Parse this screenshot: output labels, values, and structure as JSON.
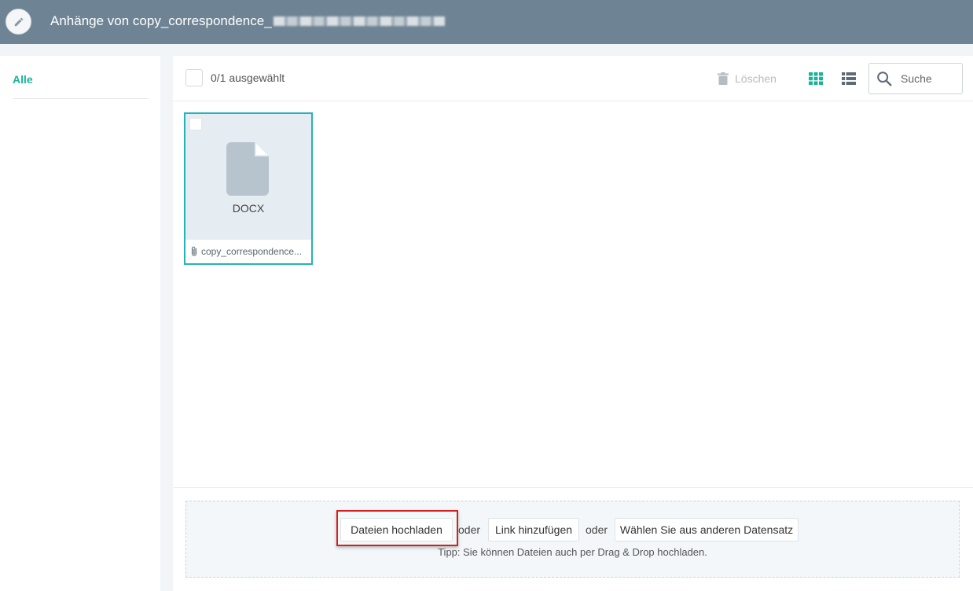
{
  "header": {
    "title": "Anhänge von copy_correspondence_"
  },
  "sidebar": {
    "items": [
      {
        "label": "Alle",
        "active": true
      }
    ]
  },
  "toolbar": {
    "selection_count": "0/1 ausgewählt",
    "delete_label": "Löschen",
    "search_placeholder": "Suche"
  },
  "files": [
    {
      "type": "DOCX",
      "name": "copy_correspondence...",
      "selected": false
    }
  ],
  "upload": {
    "upload_button": "Dateien hochladen",
    "or1": "oder",
    "add_link_button": "Link hinzufügen",
    "or2": "oder",
    "choose_other_button": "Wählen Sie aus anderen Datensatz",
    "tip": "Tipp: Sie können Dateien auch per Drag & Drop hochladen."
  },
  "colors": {
    "header_bg": "#6e8494",
    "accent": "#1ab39a",
    "card_border": "#25b3b9",
    "highlight": "#d62020"
  }
}
